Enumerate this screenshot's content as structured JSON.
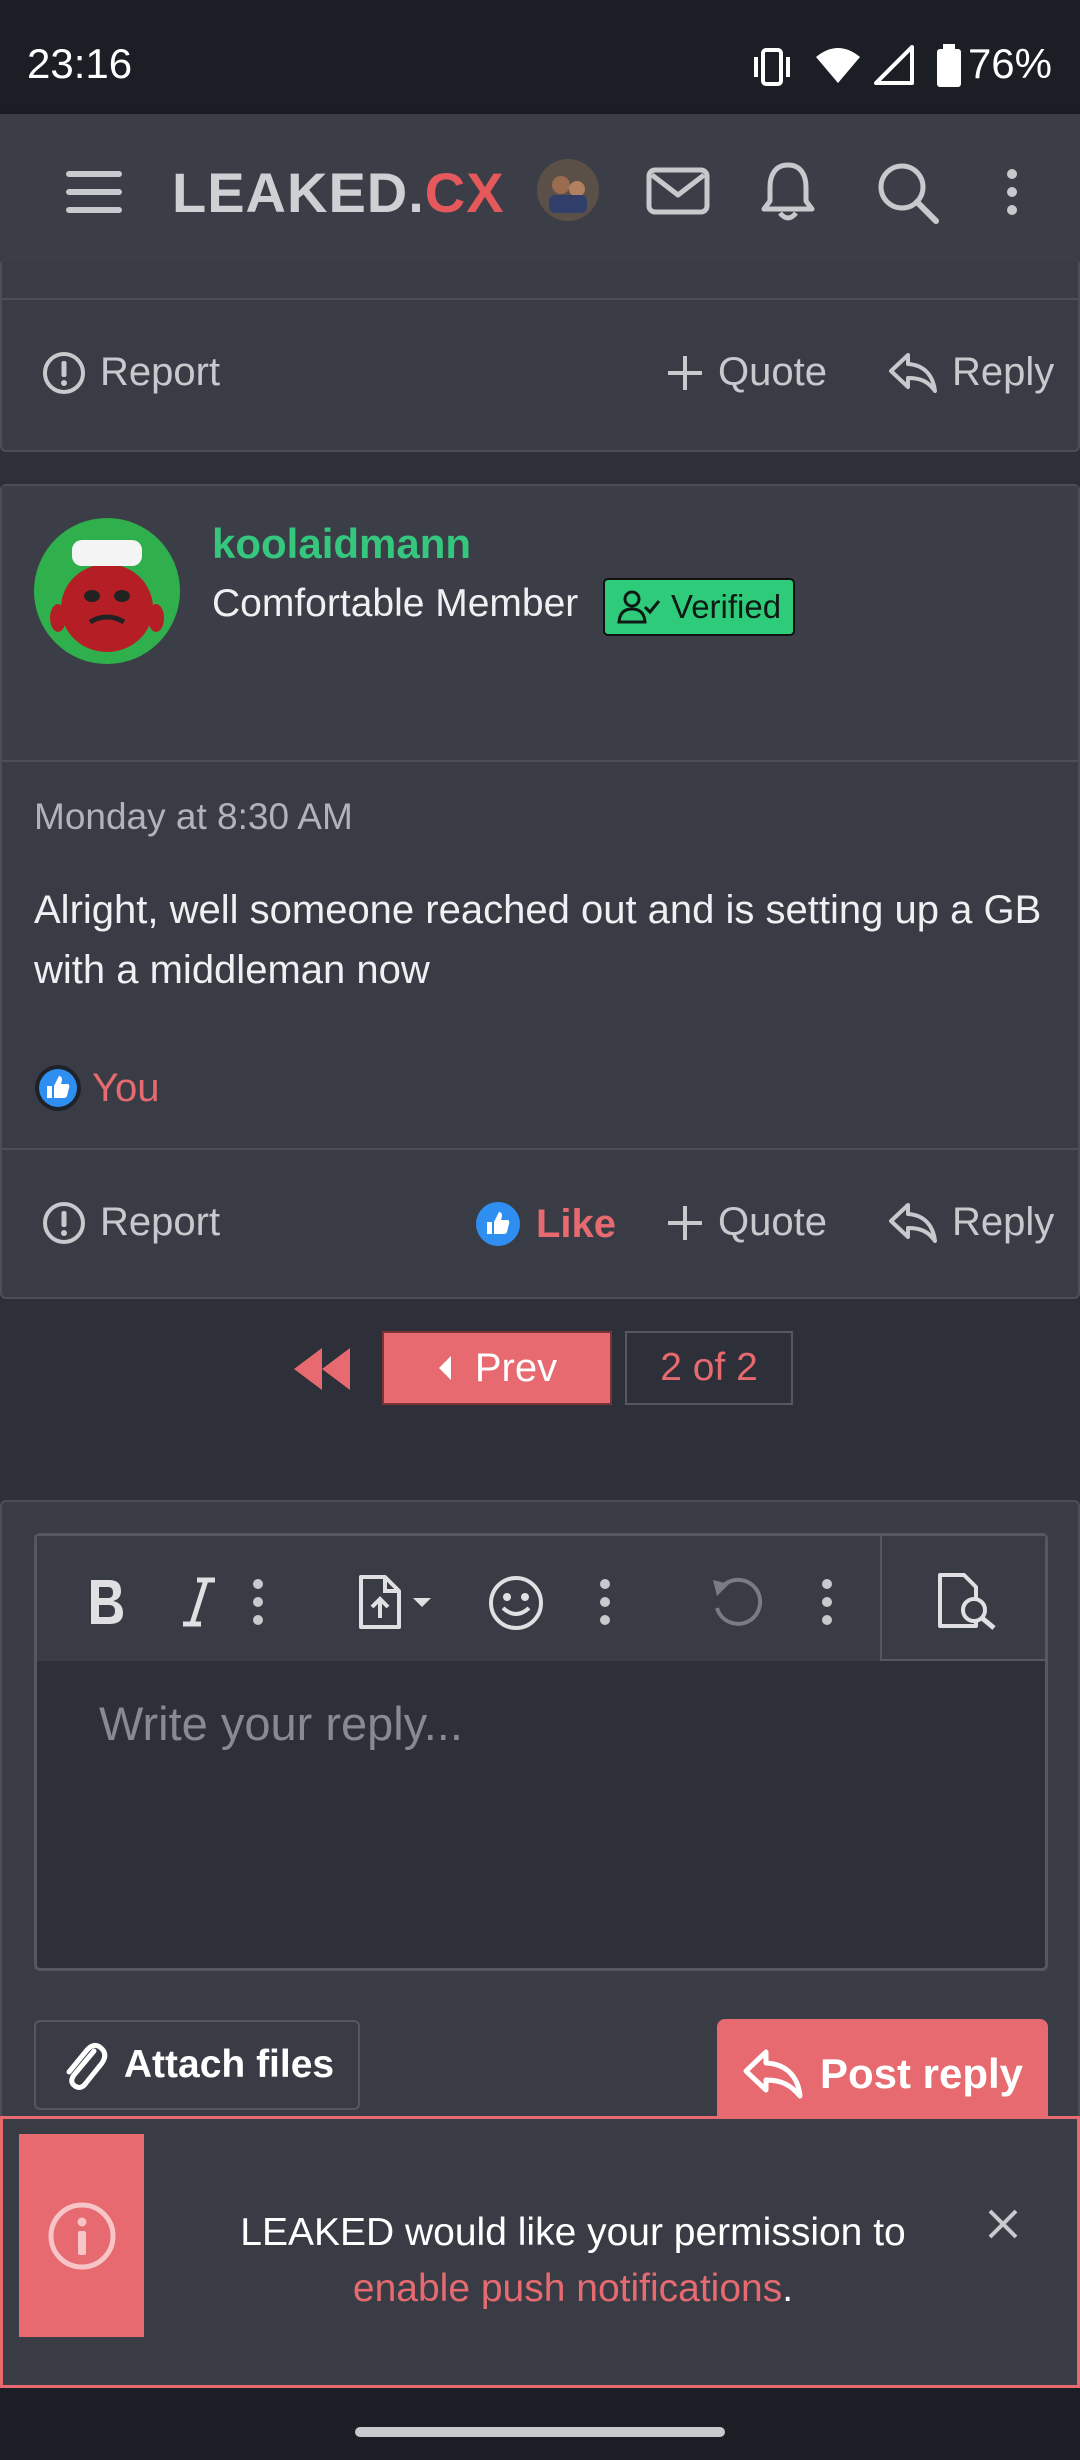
{
  "status_bar": {
    "time": "23:16",
    "battery": "76%"
  },
  "header": {
    "logo_part1": "LEAKED.",
    "logo_part2": "CX"
  },
  "prev_post_actions": {
    "report": "Report",
    "quote": "Quote",
    "reply": "Reply"
  },
  "post": {
    "username": "koolaidmann",
    "user_title": "Comfortable Member",
    "badge": "Verified",
    "date": "Monday at 8:30 AM",
    "body": "Alright, well someone reached out and is setting up a GB with a middleman now",
    "reaction_user": "You",
    "actions": {
      "report": "Report",
      "like": "Like",
      "quote": "Quote",
      "reply": "Reply"
    }
  },
  "pagination": {
    "prev": "Prev",
    "current": "2 of 2"
  },
  "editor": {
    "placeholder": "Write your reply...",
    "attach_label": "Attach files",
    "post_reply_label": "Post reply"
  },
  "notice": {
    "text_before": "LEAKED would like your permission to",
    "link_text": "enable push notifications",
    "text_after": "."
  },
  "colors": {
    "accent": "#e66a6f",
    "username": "#35c77d",
    "verified": "#2ecc7a",
    "like_blue": "#2f8ff0"
  }
}
